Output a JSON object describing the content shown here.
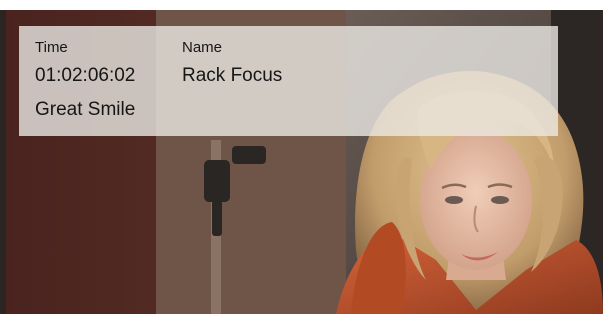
{
  "overlay": {
    "time_label": "Time",
    "time_value": "01:02:06:02",
    "name_label": "Name",
    "name_value": "Rack Focus",
    "note": "Great Smile"
  },
  "colors": {
    "overlay_bg": "#ebe8e4",
    "text": "#161616",
    "jacket": "#c9562a",
    "hair": "#c9a877",
    "background": "#3a2f2a"
  }
}
